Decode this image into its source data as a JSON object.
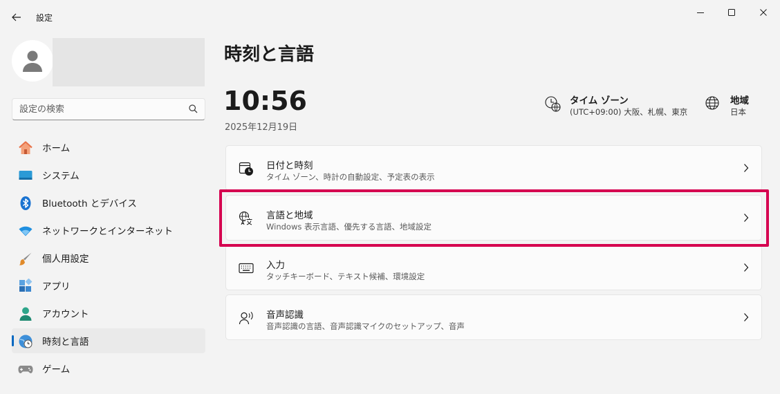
{
  "window": {
    "title": "設定",
    "controls": {
      "minimize": "minimize-icon",
      "maximize": "maximize-icon",
      "close": "close-icon"
    }
  },
  "sidebar": {
    "search": {
      "placeholder": "設定の検索"
    },
    "items": [
      {
        "label": "ホーム",
        "icon": "home-icon"
      },
      {
        "label": "システム",
        "icon": "system-icon"
      },
      {
        "label": "Bluetooth とデバイス",
        "icon": "bluetooth-icon"
      },
      {
        "label": "ネットワークとインターネット",
        "icon": "wifi-icon"
      },
      {
        "label": "個人用設定",
        "icon": "brush-icon"
      },
      {
        "label": "アプリ",
        "icon": "apps-icon"
      },
      {
        "label": "アカウント",
        "icon": "account-icon"
      },
      {
        "label": "時刻と言語",
        "icon": "globe-clock-icon",
        "active": true
      },
      {
        "label": "ゲーム",
        "icon": "gamepad-icon"
      }
    ]
  },
  "main": {
    "title": "時刻と言語",
    "clock": {
      "time": "10:56",
      "date": "2025年12月19日"
    },
    "timezone": {
      "title": "タイム ゾーン",
      "value": "(UTC+09:00) 大阪、札幌、東京"
    },
    "region": {
      "title": "地域",
      "value": "日本"
    },
    "cards": [
      {
        "title": "日付と時刻",
        "desc": "タイム ゾーン、時計の自動設定、予定表の表示",
        "icon": "calendar-clock-icon"
      },
      {
        "title": "言語と地域",
        "desc": "Windows 表示言語、優先する言語、地域設定",
        "icon": "language-icon"
      },
      {
        "title": "入力",
        "desc": "タッチキーボード、テキスト候補、環境設定",
        "icon": "keyboard-icon"
      },
      {
        "title": "音声認識",
        "desc": "音声認識の言語、音声認識マイクのセットアップ、音声",
        "icon": "speech-icon"
      }
    ]
  },
  "colors": {
    "accent": "#0067c0",
    "highlight": "#d5004f",
    "background": "#f3f3f3",
    "card": "#fbfbfb"
  }
}
